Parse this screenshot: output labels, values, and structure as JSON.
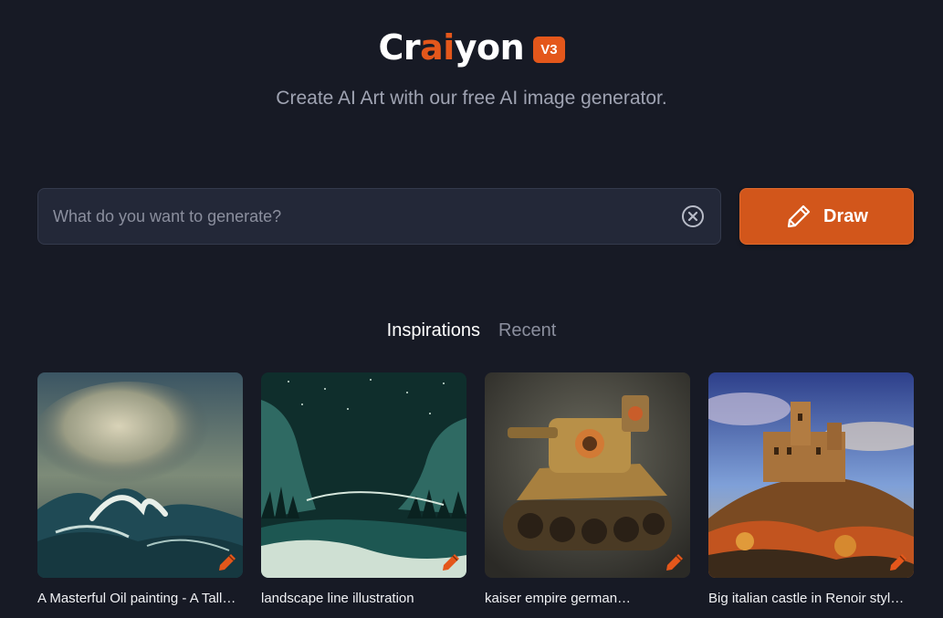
{
  "header": {
    "logo_prefix": "Cr",
    "logo_accent": "ai",
    "logo_suffix": "yon",
    "version_badge": "V3",
    "tagline": "Create AI Art with our free AI image generator."
  },
  "search": {
    "placeholder": "What do you want to generate?",
    "value": ""
  },
  "draw_button": {
    "label": "Draw",
    "icon": "pencil-icon"
  },
  "tabs": [
    {
      "label": "Inspirations",
      "active": true
    },
    {
      "label": "Recent",
      "active": false
    }
  ],
  "cards": [
    {
      "caption": "A Masterful Oil painting - A Tall…",
      "image": "stormy-sea-painting"
    },
    {
      "caption": "landscape line illustration",
      "image": "teal-landscape-illustration"
    },
    {
      "caption": "kaiser empire german…",
      "image": "steampunk-tank"
    },
    {
      "caption": "Big italian castle in Renoir styl…",
      "image": "castle-on-hill-painting"
    }
  ],
  "colors": {
    "background": "#171a25",
    "accent": "#e4571b",
    "input_bg": "#232838"
  }
}
